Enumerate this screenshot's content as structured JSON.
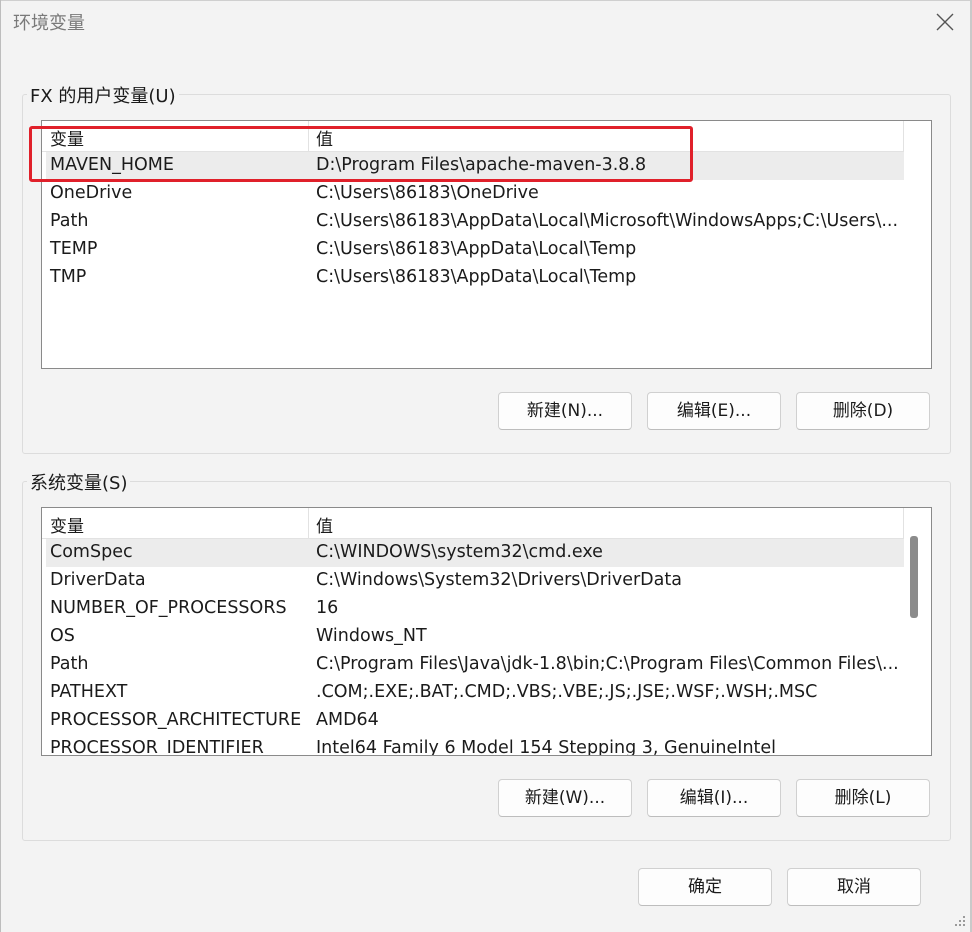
{
  "window": {
    "title": "环境变量"
  },
  "user_vars": {
    "group_label": "FX 的用户变量(U)",
    "columns": [
      "变量",
      "值"
    ],
    "rows": [
      {
        "var": "MAVEN_HOME",
        "val": "D:\\Program Files\\apache-maven-3.8.8"
      },
      {
        "var": "OneDrive",
        "val": "C:\\Users\\86183\\OneDrive"
      },
      {
        "var": "Path",
        "val": "C:\\Users\\86183\\AppData\\Local\\Microsoft\\WindowsApps;C:\\Users\\..."
      },
      {
        "var": "TEMP",
        "val": "C:\\Users\\86183\\AppData\\Local\\Temp"
      },
      {
        "var": "TMP",
        "val": "C:\\Users\\86183\\AppData\\Local\\Temp"
      }
    ],
    "buttons": {
      "new": "新建(N)...",
      "edit": "编辑(E)...",
      "delete": "删除(D)"
    }
  },
  "system_vars": {
    "group_label": "系统变量(S)",
    "columns": [
      "变量",
      "值"
    ],
    "rows": [
      {
        "var": "ComSpec",
        "val": "C:\\WINDOWS\\system32\\cmd.exe"
      },
      {
        "var": "DriverData",
        "val": "C:\\Windows\\System32\\Drivers\\DriverData"
      },
      {
        "var": "NUMBER_OF_PROCESSORS",
        "val": "16"
      },
      {
        "var": "OS",
        "val": "Windows_NT"
      },
      {
        "var": "Path",
        "val": "C:\\Program Files\\Java\\jdk-1.8\\bin;C:\\Program Files\\Common Files\\..."
      },
      {
        "var": "PATHEXT",
        "val": ".COM;.EXE;.BAT;.CMD;.VBS;.VBE;.JS;.JSE;.WSF;.WSH;.MSC"
      },
      {
        "var": "PROCESSOR_ARCHITECTURE",
        "val": "AMD64"
      },
      {
        "var": "PROCESSOR_IDENTIFIER",
        "val": "Intel64 Family 6 Model 154 Stepping 3, GenuineIntel"
      }
    ],
    "buttons": {
      "new": "新建(W)...",
      "edit": "编辑(I)...",
      "delete": "删除(L)"
    }
  },
  "dialog_buttons": {
    "ok": "确定",
    "cancel": "取消"
  },
  "colors": {
    "highlight": "#e0202a",
    "selected_row": "#ececec"
  },
  "icons": {
    "close": "close-icon",
    "resize": "resize-grip-icon"
  }
}
